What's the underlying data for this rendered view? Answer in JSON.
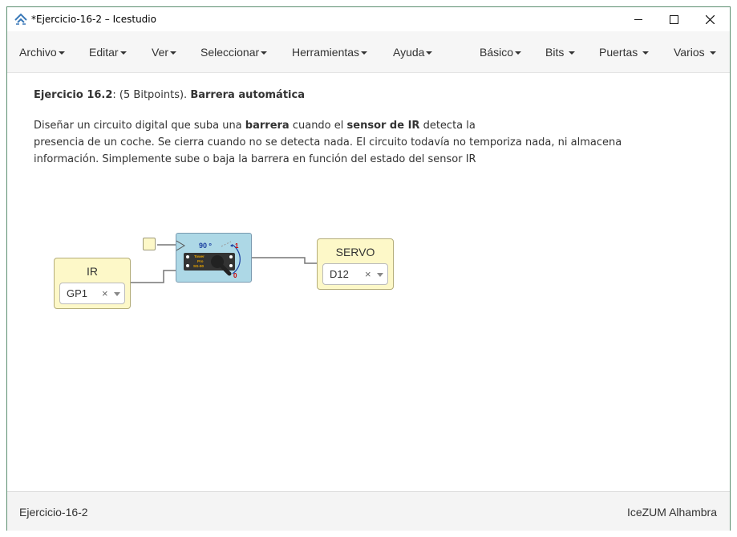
{
  "window": {
    "title": "*Ejercicio-16-2 – Icestudio",
    "controls": {
      "minimize": "—",
      "maximize": "☐",
      "close": "✕"
    }
  },
  "menu": {
    "left": [
      "Archivo",
      "Editar",
      "Ver",
      "Seleccionar",
      "Herramientas",
      "Ayuda"
    ],
    "right": [
      "Básico",
      "Bits",
      "Puertas",
      "Varios"
    ]
  },
  "description": {
    "heading_prefix": "Ejercicio 16.2",
    "heading_middle": ": (5 Bitpoints). ",
    "heading_title": "Barrera automática",
    "para_1a": "Diseñar un circuito digital que suba una ",
    "para_1b": "barrera",
    "para_1c": " cuando el ",
    "para_1d": "sensor de IR",
    "para_1e": " detecta la",
    "para_2": "presencia de un coche. Se cierra cuando no se detecta nada. El circuito todavía no temporiza nada, ni almacena",
    "para_3": "información. Simplemente sube o baja la barrera en función del estado del sensor IR"
  },
  "circuit": {
    "input_block": {
      "label": "IR",
      "pin": "GP1",
      "clear": "×"
    },
    "output_block": {
      "label": "SERVO",
      "pin": "D12",
      "clear": "×"
    },
    "servo_module": {
      "angle": "90 º",
      "mark_top": "1",
      "mark_bottom": "0",
      "chip": [
        "Tower",
        "Pro",
        "SG-90"
      ]
    }
  },
  "status": {
    "file": "Ejercicio-16-2",
    "board": "IceZUM Alhambra"
  },
  "colors": {
    "block_fill": "#fdf8c8",
    "servo_fill": "#add8e6",
    "window_border": "#5c8f70"
  }
}
